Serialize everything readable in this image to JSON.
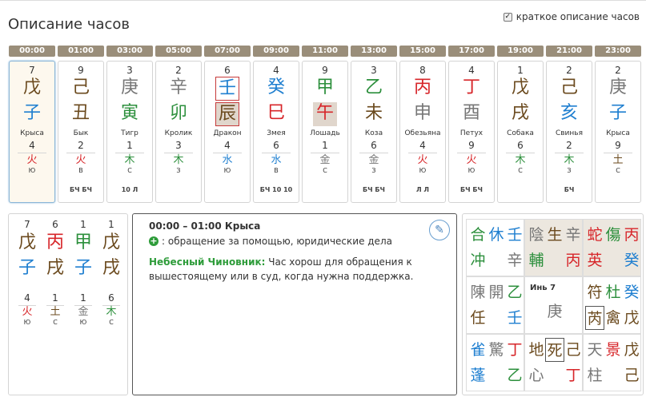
{
  "page": {
    "title": "Описание часов",
    "brief_label": "краткое описание часов",
    "brief_checked": true
  },
  "colors": {
    "fire": "#d7262a",
    "earth": "#6b4a1e",
    "metal": "#777777",
    "water": "#1f7fd0",
    "wood": "#2c8f3c",
    "hour_bar": "#9a8e7a"
  },
  "hours": [
    {
      "time": "00:00",
      "n1": "7",
      "stem": "戊",
      "stem_el": "earth",
      "branch": "子",
      "branch_el": "water",
      "animal": "Крыса",
      "n2": "4",
      "elem": "火",
      "elem_el": "fire",
      "dir": "Ю",
      "ext": "",
      "selected": true
    },
    {
      "time": "01:00",
      "n1": "9",
      "stem": "己",
      "stem_el": "earth",
      "branch": "丑",
      "branch_el": "earth",
      "animal": "Бык",
      "n2": "2",
      "elem": "火",
      "elem_el": "fire",
      "dir": "В",
      "ext": "БЧ БЧ"
    },
    {
      "time": "03:00",
      "n1": "3",
      "stem": "庚",
      "stem_el": "metal",
      "branch": "寅",
      "branch_el": "wood",
      "animal": "Тигр",
      "n2": "1",
      "elem": "木",
      "elem_el": "wood",
      "dir": "С",
      "ext": "10 Л"
    },
    {
      "time": "05:00",
      "n1": "2",
      "stem": "辛",
      "stem_el": "metal",
      "branch": "卯",
      "branch_el": "wood",
      "animal": "Кролик",
      "n2": "3",
      "elem": "木",
      "elem_el": "wood",
      "dir": "З",
      "ext": ""
    },
    {
      "time": "07:00",
      "n1": "6",
      "stem": "壬",
      "stem_el": "water",
      "stem_boxed": true,
      "branch": "辰",
      "branch_el": "earth",
      "branch_boxed": true,
      "branch_shaded": true,
      "animal": "Дракон",
      "n2": "4",
      "elem": "水",
      "elem_el": "water",
      "dir": "Ю",
      "ext": ""
    },
    {
      "time": "09:00",
      "n1": "4",
      "stem": "癸",
      "stem_el": "water",
      "branch": "巳",
      "branch_el": "fire",
      "animal": "Змея",
      "n2": "6",
      "elem": "水",
      "elem_el": "water",
      "dir": "В",
      "ext": "БЧ 10 10"
    },
    {
      "time": "11:00",
      "n1": "9",
      "stem": "甲",
      "stem_el": "wood",
      "branch": "午",
      "branch_el": "fire",
      "branch_shaded": true,
      "animal": "Лошадь",
      "n2": "1",
      "elem": "金",
      "elem_el": "metal",
      "dir": "С",
      "ext": ""
    },
    {
      "time": "13:00",
      "n1": "3",
      "stem": "乙",
      "stem_el": "wood",
      "branch": "未",
      "branch_el": "earth",
      "animal": "Коза",
      "n2": "6",
      "elem": "金",
      "elem_el": "metal",
      "dir": "З",
      "ext": "БЧ БЧ"
    },
    {
      "time": "15:00",
      "n1": "8",
      "stem": "丙",
      "stem_el": "fire",
      "branch": "申",
      "branch_el": "metal",
      "animal": "Обезьяна",
      "n2": "4",
      "elem": "火",
      "elem_el": "fire",
      "dir": "Ю",
      "ext": "Л Л"
    },
    {
      "time": "17:00",
      "n1": "4",
      "stem": "丁",
      "stem_el": "fire",
      "branch": "酉",
      "branch_el": "metal",
      "animal": "Петух",
      "n2": "9",
      "elem": "火",
      "elem_el": "fire",
      "dir": "Ю",
      "ext": "БЧ БЧ"
    },
    {
      "time": "19:00",
      "n1": "1",
      "stem": "戊",
      "stem_el": "earth",
      "branch": "戌",
      "branch_el": "earth",
      "animal": "Собака",
      "n2": "6",
      "elem": "木",
      "elem_el": "wood",
      "dir": "С",
      "ext": ""
    },
    {
      "time": "21:00",
      "n1": "2",
      "stem": "己",
      "stem_el": "earth",
      "branch": "亥",
      "branch_el": "water",
      "animal": "Свинья",
      "n2": "2",
      "elem": "木",
      "elem_el": "wood",
      "dir": "З",
      "ext": "БЧ"
    },
    {
      "time": "23:00",
      "n1": "2",
      "stem": "庚",
      "stem_el": "metal",
      "branch": "子",
      "branch_el": "water",
      "animal": "Крыса",
      "n2": "9",
      "elem": "土",
      "elem_el": "earth",
      "dir": "С",
      "ext": ""
    }
  ],
  "pillars": [
    {
      "n1": "7",
      "stem": "戊",
      "stem_el": "earth",
      "branch": "子",
      "branch_el": "water",
      "n2": "4",
      "elem": "火",
      "elem_el": "fire",
      "dir": "Ю"
    },
    {
      "n1": "6",
      "stem": "丙",
      "stem_el": "fire",
      "branch": "戌",
      "branch_el": "earth",
      "n2": "1",
      "elem": "土",
      "elem_el": "earth",
      "dir": "С"
    },
    {
      "n1": "1",
      "stem": "甲",
      "stem_el": "wood",
      "branch": "子",
      "branch_el": "water",
      "n2": "1",
      "elem": "金",
      "elem_el": "metal",
      "dir": "Ю"
    },
    {
      "n1": "1",
      "stem": "戊",
      "stem_el": "earth",
      "branch": "戌",
      "branch_el": "earth",
      "n2": "6",
      "elem": "木",
      "elem_el": "wood",
      "dir": "С"
    }
  ],
  "description": {
    "title": "00:00 – 01:00 Крыса",
    "action": ": обращение за помощью, юридические дела",
    "official_label": "Небесный Чиновник:",
    "official_text": " Час хорош для обращения к вышестоящему или в суд, когда нужна поддержка.",
    "edit_icon": "pencil-icon"
  },
  "qimen": [
    {
      "highlight": false,
      "label": "",
      "glyphs": [
        {
          "ch": "合",
          "el": "wood",
          "pos": "tl"
        },
        {
          "ch": "休",
          "el": "water",
          "pos": "tm"
        },
        {
          "ch": "壬",
          "el": "water",
          "pos": "tr"
        },
        {
          "ch": "冲",
          "el": "wood",
          "pos": "bl"
        },
        {
          "ch": "辛",
          "el": "metal",
          "pos": "br"
        }
      ]
    },
    {
      "highlight": true,
      "label": "",
      "glyphs": [
        {
          "ch": "陰",
          "el": "metal",
          "pos": "tl"
        },
        {
          "ch": "生",
          "el": "earth",
          "pos": "tm"
        },
        {
          "ch": "辛",
          "el": "metal",
          "pos": "tr"
        },
        {
          "ch": "輔",
          "el": "wood",
          "pos": "bl"
        },
        {
          "ch": "丙",
          "el": "fire",
          "pos": "br"
        }
      ]
    },
    {
      "highlight": true,
      "label": "",
      "glyphs": [
        {
          "ch": "蛇",
          "el": "fire",
          "pos": "tl"
        },
        {
          "ch": "傷",
          "el": "wood",
          "pos": "tm"
        },
        {
          "ch": "丙",
          "el": "fire",
          "pos": "tr"
        },
        {
          "ch": "英",
          "el": "fire",
          "pos": "bl"
        },
        {
          "ch": "癸",
          "el": "water",
          "pos": "br"
        }
      ]
    },
    {
      "highlight": false,
      "label": "",
      "glyphs": [
        {
          "ch": "陳",
          "el": "metal",
          "pos": "tl"
        },
        {
          "ch": "開",
          "el": "metal",
          "pos": "tm"
        },
        {
          "ch": "乙",
          "el": "wood",
          "pos": "tr"
        },
        {
          "ch": "任",
          "el": "earth",
          "pos": "bl"
        },
        {
          "ch": "壬",
          "el": "water",
          "pos": "br"
        }
      ]
    },
    {
      "highlight": false,
      "label": "Инь 7",
      "glyphs": [
        {
          "ch": "庚",
          "el": "metal",
          "pos": "cm"
        }
      ]
    },
    {
      "highlight": false,
      "label": "",
      "glyphs": [
        {
          "ch": "符",
          "el": "earth",
          "pos": "tl"
        },
        {
          "ch": "杜",
          "el": "wood",
          "pos": "tm"
        },
        {
          "ch": "癸",
          "el": "water",
          "pos": "tr"
        },
        {
          "ch": "芮",
          "el": "earth",
          "pos": "bl",
          "boxed": true
        },
        {
          "ch": "禽",
          "el": "earth",
          "pos": "bm"
        },
        {
          "ch": "戊",
          "el": "earth",
          "pos": "br"
        }
      ]
    },
    {
      "highlight": false,
      "label": "",
      "glyphs": [
        {
          "ch": "雀",
          "el": "water",
          "pos": "tl"
        },
        {
          "ch": "驚",
          "el": "metal",
          "pos": "tm"
        },
        {
          "ch": "丁",
          "el": "fire",
          "pos": "tr"
        },
        {
          "ch": "蓬",
          "el": "water",
          "pos": "bl"
        },
        {
          "ch": "乙",
          "el": "wood",
          "pos": "br"
        }
      ]
    },
    {
      "highlight": false,
      "label": "",
      "glyphs": [
        {
          "ch": "地",
          "el": "earth",
          "pos": "tl"
        },
        {
          "ch": "死",
          "el": "earth",
          "pos": "tm",
          "boxed": true
        },
        {
          "ch": "己",
          "el": "earth",
          "pos": "tr"
        },
        {
          "ch": "心",
          "el": "metal",
          "pos": "bl"
        },
        {
          "ch": "丁",
          "el": "fire",
          "pos": "br"
        }
      ]
    },
    {
      "highlight": false,
      "label": "",
      "glyphs": [
        {
          "ch": "天",
          "el": "metal",
          "pos": "tl"
        },
        {
          "ch": "景",
          "el": "fire",
          "pos": "tm"
        },
        {
          "ch": "戊",
          "el": "earth",
          "pos": "tr"
        },
        {
          "ch": "柱",
          "el": "metal",
          "pos": "bl"
        },
        {
          "ch": "己",
          "el": "earth",
          "pos": "br"
        }
      ]
    }
  ]
}
